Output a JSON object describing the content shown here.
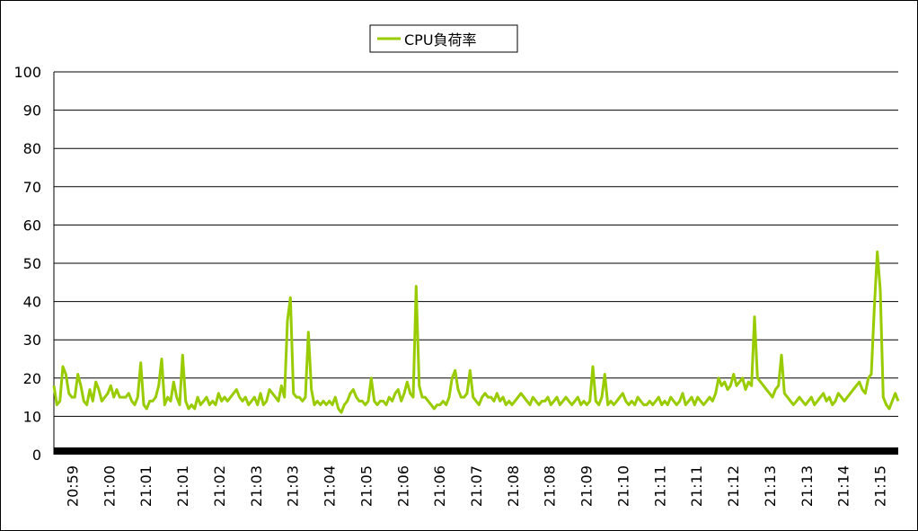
{
  "chart_data": {
    "type": "line",
    "title": "",
    "xlabel": "",
    "ylabel": "",
    "ylim": [
      0,
      100
    ],
    "yticks": [
      "0",
      "10",
      "20",
      "30",
      "40",
      "50",
      "60",
      "70",
      "80",
      "90",
      "100"
    ],
    "grid": "horizontal",
    "legend": "top-center",
    "x_tick_labels": [
      "20:59",
      "21:00",
      "21:01",
      "21:01",
      "21:02",
      "21:03",
      "21:03",
      "21:04",
      "21:05",
      "21:06",
      "21:06",
      "21:07",
      "21:08",
      "21:08",
      "21:09",
      "21:10",
      "21:11",
      "21:11",
      "21:12",
      "21:13",
      "21:13",
      "21:14",
      "21:15"
    ],
    "series": [
      {
        "name": "CPU負荷率",
        "color": "#99cc00",
        "values": [
          18,
          13,
          14,
          23,
          21,
          16,
          15,
          15,
          21,
          18,
          14,
          13,
          17,
          14,
          19,
          17,
          14,
          15,
          16,
          18,
          15,
          17,
          15,
          15,
          15,
          16,
          14,
          13,
          15,
          24,
          13,
          12,
          14,
          14,
          15,
          18,
          25,
          13,
          15,
          14,
          19,
          15,
          13,
          26,
          14,
          12,
          13,
          12,
          15,
          13,
          14,
          15,
          13,
          14,
          13,
          16,
          14,
          15,
          14,
          15,
          16,
          17,
          15,
          14,
          15,
          13,
          14,
          15,
          13,
          16,
          13,
          14,
          17,
          16,
          15,
          14,
          18,
          15,
          35,
          41,
          16,
          15,
          15,
          14,
          15,
          32,
          17,
          13,
          14,
          13,
          14,
          13,
          14,
          13,
          15,
          12,
          11,
          13,
          14,
          16,
          17,
          15,
          14,
          14,
          13,
          14,
          20,
          14,
          13,
          14,
          14,
          13,
          15,
          14,
          16,
          17,
          14,
          16,
          19,
          16,
          15,
          44,
          18,
          15,
          15,
          14,
          13,
          12,
          13,
          13,
          14,
          13,
          15,
          20,
          22,
          17,
          15,
          15,
          16,
          22,
          15,
          14,
          13,
          15,
          16,
          15,
          15,
          14,
          16,
          14,
          15,
          13,
          14,
          13,
          14,
          15,
          16,
          15,
          14,
          13,
          15,
          14,
          13,
          14,
          14,
          15,
          13,
          14,
          15,
          13,
          14,
          15,
          14,
          13,
          14,
          15,
          13,
          14,
          13,
          14,
          23,
          14,
          13,
          15,
          21,
          13,
          14,
          13,
          14,
          15,
          16,
          14,
          13,
          14,
          13,
          15,
          14,
          13,
          13,
          14,
          13,
          14,
          15,
          13,
          14,
          13,
          15,
          14,
          13,
          14,
          16,
          13,
          14,
          15,
          13,
          15,
          14,
          13,
          14,
          15,
          14,
          16,
          20,
          18,
          19,
          17,
          18,
          21,
          18,
          19,
          20,
          17,
          19,
          18,
          36,
          20,
          19,
          18,
          17,
          16,
          15,
          17,
          18,
          26,
          16,
          15,
          14,
          13,
          14,
          15,
          14,
          13,
          14,
          15,
          13,
          14,
          15,
          16,
          14,
          15,
          13,
          14,
          16,
          15,
          14,
          15,
          16,
          17,
          18,
          19,
          17,
          16,
          20,
          21,
          38,
          53,
          43,
          15,
          13,
          12,
          14,
          16,
          14
        ]
      }
    ]
  }
}
